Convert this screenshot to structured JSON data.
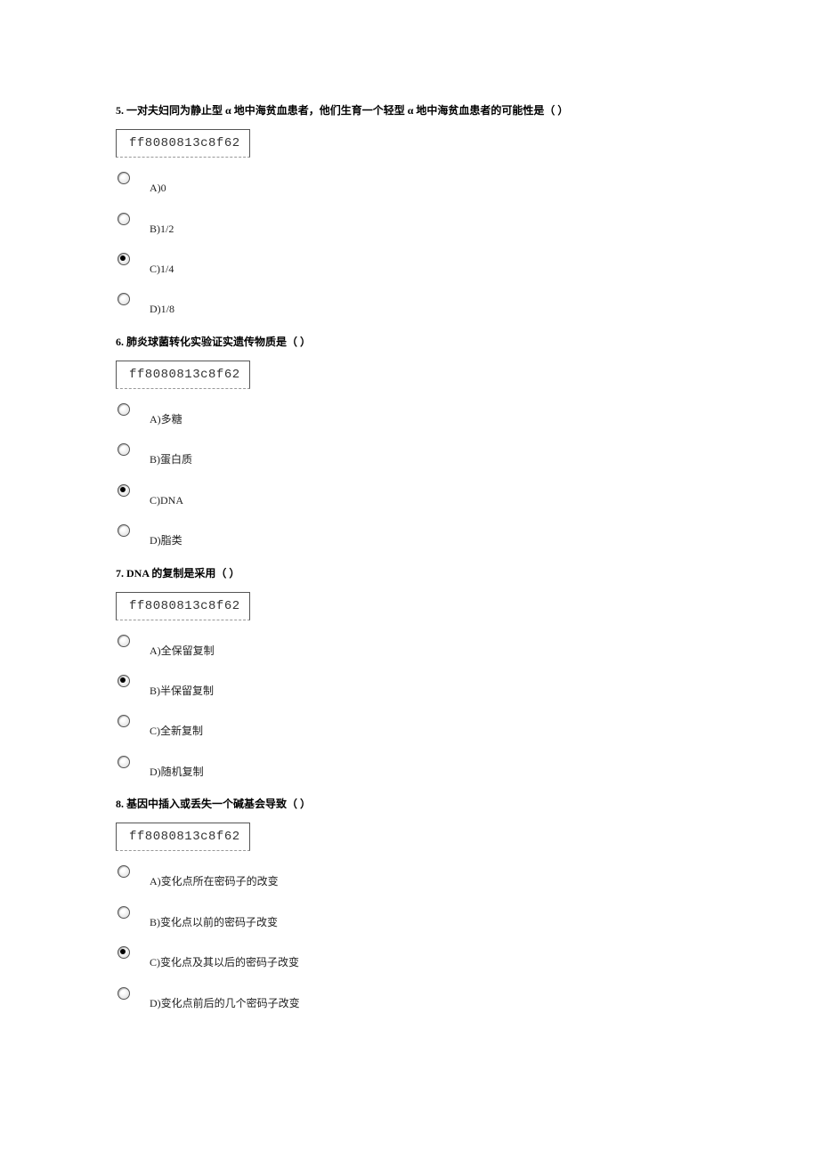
{
  "questions": [
    {
      "number": "5.",
      "text": "一对夫妇同为静止型 α 地中海贫血患者，他们生育一个轻型 α 地中海贫血患者的可能性是（ ）",
      "code": "ff8080813c8f62",
      "options": [
        {
          "label": "A)0",
          "selected": false
        },
        {
          "label": "B)1/2",
          "selected": false
        },
        {
          "label": "C)1/4",
          "selected": true
        },
        {
          "label": "D)1/8",
          "selected": false
        }
      ]
    },
    {
      "number": "6.",
      "text": "肺炎球菌转化实验证实遗传物质是（ ）",
      "code": "ff8080813c8f62",
      "options": [
        {
          "label": "A)多糖",
          "selected": false
        },
        {
          "label": "B)蛋白质",
          "selected": false
        },
        {
          "label": "C)DNA",
          "selected": true
        },
        {
          "label": "D)脂类",
          "selected": false
        }
      ]
    },
    {
      "number": "7.",
      "text": "DNA 的复制是采用（ ）",
      "code": "ff8080813c8f62",
      "options": [
        {
          "label": "A)全保留复制",
          "selected": false
        },
        {
          "label": "B)半保留复制",
          "selected": true
        },
        {
          "label": "C)全新复制",
          "selected": false
        },
        {
          "label": "D)随机复制",
          "selected": false
        }
      ]
    },
    {
      "number": "8.",
      "text": "基因中插入或丢失一个碱基会导致（ ）",
      "code": "ff8080813c8f62",
      "options": [
        {
          "label": "A)变化点所在密码子的改变",
          "selected": false
        },
        {
          "label": "B)变化点以前的密码子改变",
          "selected": false
        },
        {
          "label": "C)变化点及其以后的密码子改变",
          "selected": true
        },
        {
          "label": "D)变化点前后的几个密码子改变",
          "selected": false
        }
      ]
    }
  ]
}
